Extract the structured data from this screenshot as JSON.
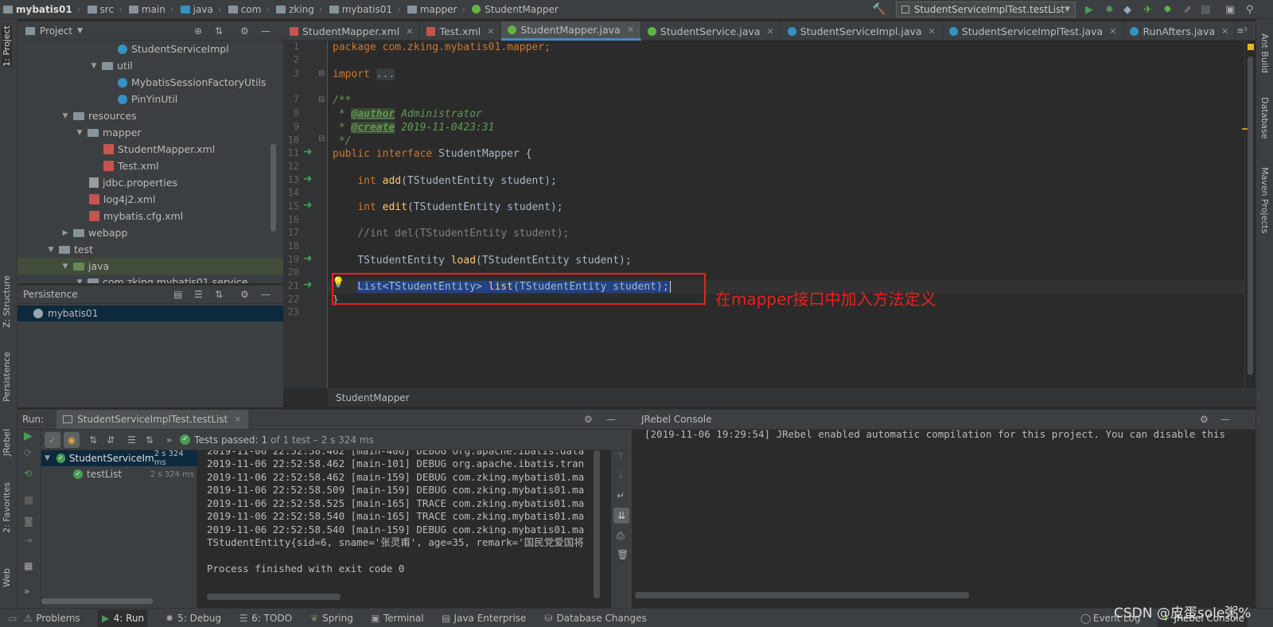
{
  "breadcrumbs": [
    "mybatis01",
    "src",
    "main",
    "java",
    "com",
    "zking",
    "mybatis01",
    "mapper",
    "StudentMapper"
  ],
  "run_config": "StudentServiceImplTest.testList",
  "project_panel": {
    "title": "Project",
    "tree": [
      {
        "label": "StudentServiceImpl",
        "icon": "class-icon"
      },
      {
        "label": "util",
        "icon": "folder-icon",
        "arrow": "▼"
      },
      {
        "label": "MybatisSessionFactoryUtils",
        "icon": "class-icon"
      },
      {
        "label": "PinYinUtil",
        "icon": "class-icon"
      },
      {
        "label": "resources",
        "icon": "folder-icon",
        "arrow": "▼"
      },
      {
        "label": "mapper",
        "icon": "folder-icon",
        "arrow": "▼"
      },
      {
        "label": "StudentMapper.xml",
        "icon": "xml-icon"
      },
      {
        "label": "Test.xml",
        "icon": "xml-icon"
      },
      {
        "label": "jdbc.properties",
        "icon": "properties-icon"
      },
      {
        "label": "log4j2.xml",
        "icon": "xml-icon"
      },
      {
        "label": "mybatis.cfg.xml",
        "icon": "xml-icon"
      },
      {
        "label": "webapp",
        "icon": "folder-icon",
        "arrow": "▶"
      },
      {
        "label": "test",
        "icon": "folder-icon",
        "arrow": "▼"
      },
      {
        "label": "java",
        "icon": "folder-green-icon",
        "arrow": "▼"
      },
      {
        "label": "com.zking.mybatis01.service",
        "icon": "folder-icon",
        "arrow": "▼"
      }
    ]
  },
  "persistence_panel": {
    "title": "Persistence",
    "items": [
      "mybatis01"
    ]
  },
  "left_strip": {
    "project": "1: Project",
    "structure": "Z: Structure",
    "persistence": "Persistence",
    "jrebel": "JRebel",
    "favorites": "2: Favorites",
    "web": "Web"
  },
  "right_strip": {
    "ant": "Ant Build",
    "database": "Database",
    "maven": "Maven Projects"
  },
  "editor_tabs": [
    {
      "label": "StudentMapper.xml",
      "icon": "xml",
      "active": false
    },
    {
      "label": "Test.xml",
      "icon": "xml",
      "active": false
    },
    {
      "label": "StudentMapper.java",
      "icon": "interface",
      "active": true
    },
    {
      "label": "StudentService.java",
      "icon": "interface",
      "active": false
    },
    {
      "label": "StudentServiceImpl.java",
      "icon": "class",
      "active": false
    },
    {
      "label": "StudentServiceImplTest.java",
      "icon": "testclass",
      "active": false
    },
    {
      "label": "RunAfters.java",
      "icon": "class",
      "active": false
    }
  ],
  "code": {
    "line_numbers": [
      "1",
      "2",
      "3",
      "7",
      "8",
      "9",
      "10",
      "11",
      "12",
      "13",
      "14",
      "15",
      "16",
      "17",
      "18",
      "19",
      "20",
      "21",
      "22",
      "23"
    ],
    "package": "package com.zking.mybatis01.mapper;",
    "import_kw": "import",
    "import_fold": "...",
    "doc_open": "/**",
    "author_tag": "@author",
    "author_val": " Administrator",
    "create_tag": "@create",
    "create_val": " 2019-11-0423:31",
    "doc_close": " */",
    "iface_public": "public",
    "iface_interface": "interface",
    "iface_name": " StudentMapper {",
    "add_type": "int",
    "add_name": "add",
    "add_params": "(TStudentEntity student);",
    "edit_type": "int",
    "edit_name": "edit",
    "edit_params": "(TStudentEntity student);",
    "del_comment": "//int del(TStudentEntity student);",
    "load_type": "TStudentEntity ",
    "load_name": "load",
    "load_params": "(TStudentEntity student);",
    "list_type": "List<TStudentEntity> ",
    "list_name": "list",
    "list_params": "(TStudentEntity student);",
    "close_brace": "}"
  },
  "editor_breadcrumb": "StudentMapper",
  "annotation": "在mapper接口中加入方法定义",
  "run_panel": {
    "title": "Run:",
    "tab": "StudentServiceImplTest.testList",
    "tests_passed_label": "Tests passed:",
    "tests_passed_value": "1",
    "tests_passed_rest": "of 1 test – 2 s 324 ms",
    "tree": [
      {
        "label": "StudentServiceIm",
        "time": "2 s 324 ms"
      },
      {
        "label": "testList",
        "time": "2 s 324 ms"
      }
    ],
    "console": [
      "2019-11-06 22:52:58.462 [main-406] DEBUG org.apache.ibatis.data",
      "2019-11-06 22:52:58.462 [main-101] DEBUG org.apache.ibatis.tran",
      "2019-11-06 22:52:58.462 [main-159] DEBUG com.zking.mybatis01.ma",
      "2019-11-06 22:52:58.509 [main-159] DEBUG com.zking.mybatis01.ma",
      "2019-11-06 22:52:58.525 [main-165] TRACE com.zking.mybatis01.ma",
      "2019-11-06 22:52:58.540 [main-165] TRACE com.zking.mybatis01.ma",
      "2019-11-06 22:52:58.540 [main-159] DEBUG com.zking.mybatis01.ma",
      "TStudentEntity{sid=6, sname='张灵甫', age=35, remark='国民党爱国将",
      "",
      "Process finished with exit code 0"
    ]
  },
  "jrebel_panel": {
    "title": "JRebel Console",
    "line": "[2019-11-06 19:29:54] JRebel enabled automatic compilation for this project. You can disable this"
  },
  "status_bar": {
    "problems": "Problems",
    "run": "4: Run",
    "debug": "5: Debug",
    "todo": "6: TODO",
    "spring": "Spring",
    "terminal": "Terminal",
    "javaee": "Java Enterprise",
    "dbchanges": "Database Changes",
    "eventlog": "Event Log",
    "jrebelconsole": "JRebel Console"
  },
  "watermark": "CSDN @皮蛋sole粥%",
  "colors": {
    "accent": "#4a88c7",
    "keyword": "#cc7832",
    "method": "#ffc66d",
    "annotation_red": "#e8211d",
    "gutter_run": "#499c54",
    "selection": "#214283"
  }
}
